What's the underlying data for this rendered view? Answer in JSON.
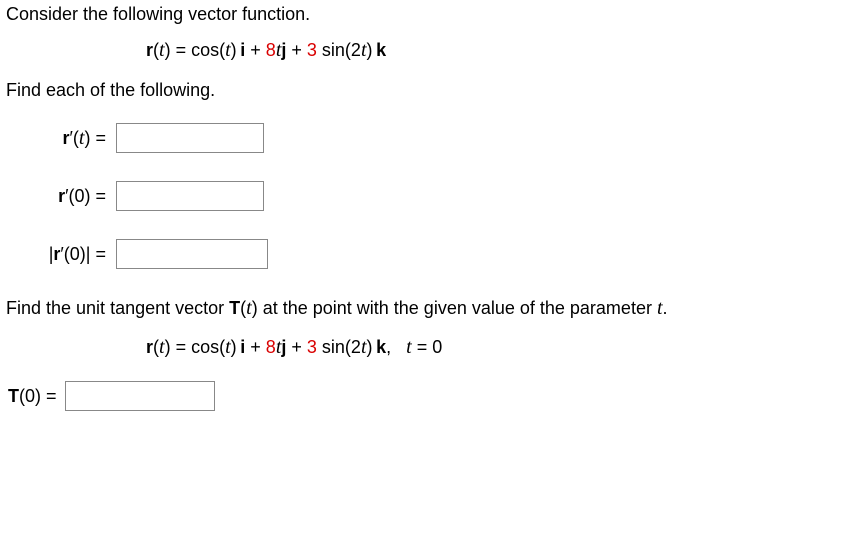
{
  "intro": "Consider the following vector function.",
  "formula1": {
    "lhs_bold": "r",
    "lhs_rest": "(",
    "lhs_var": "t",
    "lhs_close": ") = cos(",
    "lhs_var2": "t",
    "lhs_after_cos": ")",
    "i": "i",
    "plus1": " + ",
    "coef8": "8",
    "t_after8": "t",
    "j": "j",
    "plus2": " + ",
    "coef3": "3",
    "sin_part": " sin(2",
    "t_sin": "t",
    "sin_close": ")",
    "k": "k"
  },
  "sub_intro": "Find each of the following.",
  "rows": {
    "r1": {
      "b": "r",
      "prime": "′",
      "open": "(",
      "var": "t",
      "close": ")",
      "eq": " ="
    },
    "r2": {
      "b": "r",
      "prime": "′",
      "open": "(",
      "zero": "0",
      "close": ")",
      "eq": " ="
    },
    "r3": {
      "bar1": "|",
      "b": "r",
      "prime": "′",
      "open": "(",
      "zero": "0",
      "close": ")",
      "bar2": "|",
      "eq": " ="
    }
  },
  "second_intro_pre": "Find the unit tangent vector ",
  "second_intro_T": "T",
  "second_intro_paren_open": "(",
  "second_intro_var": "t",
  "second_intro_paren_close": ")",
  "second_intro_mid": " at the point with the given value of the parameter ",
  "second_intro_var2": "t",
  "second_intro_end": ".",
  "formula2_extra": {
    "comma": ",   ",
    "teq": "t",
    "eq0": " = 0"
  },
  "t0": {
    "T": "T",
    "rest": "(0) ="
  }
}
